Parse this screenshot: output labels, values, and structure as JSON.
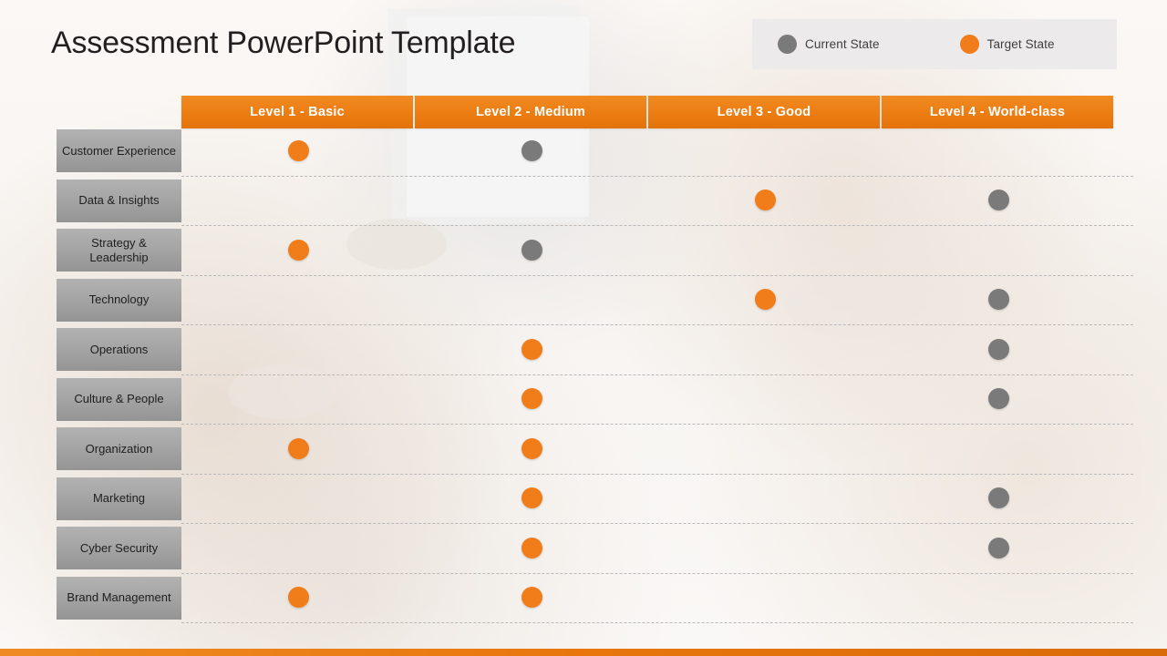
{
  "title": "Assessment PowerPoint Template",
  "colors": {
    "current_state": "#7a7a7a",
    "target_state": "#f07d1a",
    "header_orange": "#ec7d12",
    "row_label_gray": "#a4a4a4"
  },
  "legend": {
    "items": [
      {
        "label": "Current State",
        "color": "#7a7a7a",
        "icon": "circle-icon"
      },
      {
        "label": "Target State",
        "color": "#f07d1a",
        "icon": "circle-icon"
      }
    ]
  },
  "matrix": {
    "columns": [
      "Level 1 - Basic",
      "Level 2 - Medium",
      "Level 3 - Good",
      "Level 4 - World-class"
    ],
    "rows": [
      {
        "label": "Customer Experience",
        "cells": [
          {
            "marker": "target"
          },
          {
            "marker": "current"
          },
          {
            "marker": "none"
          },
          {
            "marker": "none"
          }
        ]
      },
      {
        "label": "Data & Insights",
        "cells": [
          {
            "marker": "none"
          },
          {
            "marker": "none"
          },
          {
            "marker": "target"
          },
          {
            "marker": "current"
          }
        ]
      },
      {
        "label": "Strategy & Leadership",
        "cells": [
          {
            "marker": "target"
          },
          {
            "marker": "current"
          },
          {
            "marker": "none"
          },
          {
            "marker": "none"
          }
        ]
      },
      {
        "label": "Technology",
        "cells": [
          {
            "marker": "none"
          },
          {
            "marker": "none"
          },
          {
            "marker": "target"
          },
          {
            "marker": "current"
          }
        ]
      },
      {
        "label": "Operations",
        "cells": [
          {
            "marker": "none"
          },
          {
            "marker": "target"
          },
          {
            "marker": "none"
          },
          {
            "marker": "current"
          }
        ]
      },
      {
        "label": "Culture & People",
        "cells": [
          {
            "marker": "none"
          },
          {
            "marker": "target"
          },
          {
            "marker": "none"
          },
          {
            "marker": "current"
          }
        ]
      },
      {
        "label": "Organization",
        "cells": [
          {
            "marker": "target"
          },
          {
            "marker": "target"
          },
          {
            "marker": "none"
          },
          {
            "marker": "none"
          }
        ]
      },
      {
        "label": "Marketing",
        "cells": [
          {
            "marker": "none"
          },
          {
            "marker": "target"
          },
          {
            "marker": "none"
          },
          {
            "marker": "current"
          }
        ]
      },
      {
        "label": "Cyber Security",
        "cells": [
          {
            "marker": "none"
          },
          {
            "marker": "target"
          },
          {
            "marker": "none"
          },
          {
            "marker": "current"
          }
        ]
      },
      {
        "label": "Brand Management",
        "cells": [
          {
            "marker": "target"
          },
          {
            "marker": "target"
          },
          {
            "marker": "none"
          },
          {
            "marker": "none"
          }
        ]
      }
    ]
  }
}
